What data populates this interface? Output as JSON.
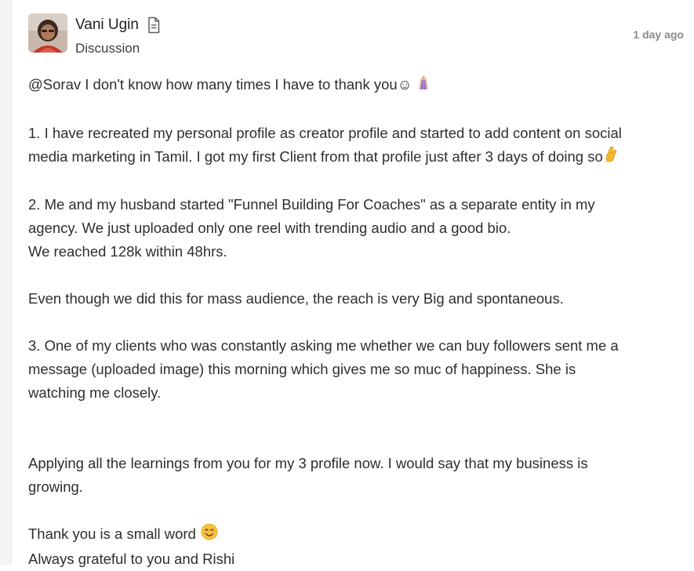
{
  "post": {
    "author": {
      "name": "Vani Ugin",
      "avatar_icon": "user-avatar-photo",
      "badge_icon": "document-icon"
    },
    "category": "Discussion",
    "timestamp": "1 day ago",
    "lines": {
      "l1": "@Sorav I don't know how many times I have to thank you☺",
      "l2": "1. I have recreated my personal profile as creator profile and started to add content on social",
      "l3": "media marketing in Tamil. I got my first Client from that profile just after 3 days of doing so",
      "l4": "2. Me and my husband started \"Funnel Building For Coaches\" as a separate entity in my",
      "l5": "agency. We just uploaded only one reel with trending audio and a good bio.",
      "l6": "We reached 128k within 48hrs.",
      "l7": "Even though we did this for mass audience, the reach is very Big and spontaneous.",
      "l8": "3. One of my clients who was constantly asking me whether we can buy followers sent me a",
      "l9": "message (uploaded image) this morning which gives me so muc of happiness. She is",
      "l10": "watching me closely.",
      "l11": "Applying all the learnings from you for my 3 profile now. I would say that my business is",
      "l12": "growing.",
      "l13": "Thank you is a small word",
      "l14": "Always grateful to you and Rishi"
    },
    "emojis": {
      "thank_you": "folded-hands-emoji",
      "fingers": "crossed-fingers-emoji",
      "smile": "smiling-face-emoji"
    }
  }
}
